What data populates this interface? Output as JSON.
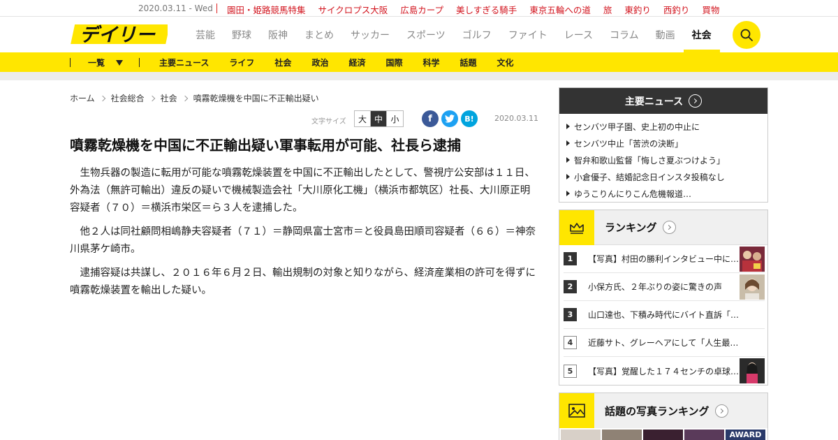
{
  "topbar": {
    "date": "2020.03.11 - Wed",
    "links": [
      "園田・姫路競馬特集",
      "サイクロプス大阪",
      "広島カープ",
      "美しすぎる騎手",
      "東京五輪への道",
      "旅",
      "東釣り",
      "西釣り",
      "買物"
    ]
  },
  "header": {
    "logo_text": "デイリー",
    "nav": [
      "芸能",
      "野球",
      "阪神",
      "まとめ",
      "サッカー",
      "スポーツ",
      "ゴルフ",
      "ファイト",
      "レース",
      "コラム",
      "動画",
      "社会"
    ],
    "active_nav": "社会",
    "search_icon": "search-icon"
  },
  "subnav": {
    "menu_label": "一覧",
    "links": [
      "主要ニュース",
      "ライフ",
      "社会",
      "政治",
      "経済",
      "国際",
      "科学",
      "話題",
      "文化"
    ]
  },
  "breadcrumb": [
    "ホーム",
    "社会総合",
    "社会",
    "噴霧乾燥機を中国に不正輸出疑い"
  ],
  "tools": {
    "fontsize_label": "文字サイズ",
    "sizes": [
      "大",
      "中",
      "小"
    ],
    "selected_size": "中",
    "share": {
      "facebook": "f",
      "twitter": "t",
      "hatena": "B!"
    },
    "date": "2020.03.11"
  },
  "article": {
    "headline": "噴霧乾燥機を中国に不正輸出疑い軍事転用が可能、社長ら逮捕",
    "paragraphs": [
      "生物兵器の製造に転用が可能な噴霧乾燥装置を中国に不正輸出したとして、警視庁公安部は１１日、外為法（無許可輸出）違反の疑いで機械製造会社「大川原化工機」（横浜市都筑区）社長、大川原正明容疑者（７０）＝横浜市栄区＝ら３人を逮捕した。",
      "他２人は同社顧問相嶋静夫容疑者（７１）＝静岡県富士宮市＝と役員島田順司容疑者（６６）＝神奈川県茅ケ崎市。",
      "逮捕容疑は共謀し、２０１６年６月２日、輸出規制の対象と知りながら、経済産業相の許可を得ずに噴霧乾燥装置を輸出した疑い。"
    ]
  },
  "sidebar": {
    "main_news": {
      "title": "主要ニュース",
      "items": [
        "センバツ甲子園、史上初の中止に",
        "センバツ中止「苦渋の決断」",
        "智弁和歌山監督「悔しさ夏ぶつけよう」",
        "小倉優子、結婚記念日インスタ投稿なし",
        "ゆうこりんにりこん危機報道…"
      ]
    },
    "ranking": {
      "title": "ランキング",
      "items": [
        {
          "rank": "1",
          "text": "【写真】村田の勝利インタビュー中に…",
          "has_thumb": true
        },
        {
          "rank": "2",
          "text": "小保方氏、２年ぶりの姿に驚きの声",
          "has_thumb": true
        },
        {
          "rank": "3",
          "text": "山口達也、下積み時代にバイト直訴「働か…",
          "has_thumb": false
        },
        {
          "rank": "4",
          "text": "近藤サト、グレーヘアにして「人生最高の…",
          "has_thumb": false
        },
        {
          "rank": "5",
          "text": "【写真】覚醒した１７４センチの卓球…",
          "has_thumb": true
        }
      ]
    },
    "photo_ranking": {
      "title": "話題の写真ランキング",
      "thumb_label": "AWARD"
    }
  },
  "colors": {
    "brand_yellow": "#ffe600",
    "top_link_red": "#d2141e",
    "dark_header": "#333333"
  }
}
